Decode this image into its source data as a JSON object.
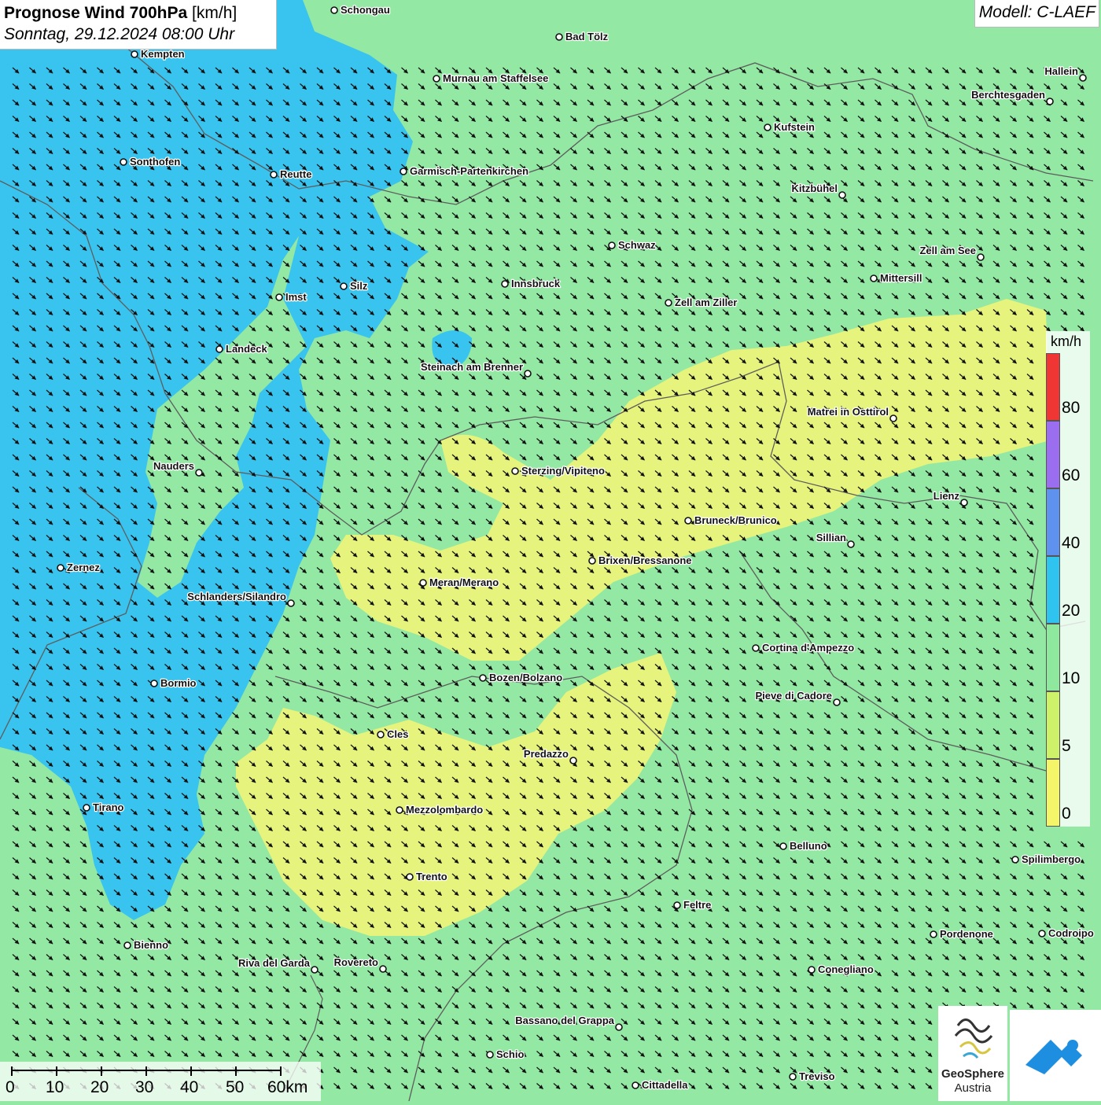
{
  "header": {
    "title_bold": "Prognose Wind 700hPa",
    "title_unit": " [km/h]",
    "subtitle": "Sonntag, 29.12.2024 08:00 Uhr",
    "model": "Modell: C-LAEF"
  },
  "legend": {
    "unit": "km/h",
    "ticks": [
      "80",
      "60",
      "40",
      "20",
      "10",
      "5",
      "0"
    ],
    "colors": [
      "#f03535",
      "#9b6ef0",
      "#5e92ee",
      "#2fc3ef",
      "#8ee89e",
      "#cdf26a",
      "#f5f56a"
    ]
  },
  "scale_bar": {
    "labels": [
      "0",
      "10",
      "20",
      "30",
      "40",
      "50",
      "60km"
    ]
  },
  "logos": {
    "geosphere_line1": "GeoSphere",
    "geosphere_line2": "Austria"
  },
  "colors": {
    "blue_zone": "#39c3ef",
    "green_zone": "#93e8a3",
    "yellow_zone": "#e6f37c",
    "border_line": "#5d5d5d",
    "arrow": "#111111"
  },
  "wind": {
    "direction": "north-west to south-east",
    "level": "700hPa"
  },
  "cities": [
    {
      "name": "Schongau"
    },
    {
      "name": "Bad Tölz"
    },
    {
      "name": "Kempten"
    },
    {
      "name": "Murnau am Staffelsee"
    },
    {
      "name": "Hallein"
    },
    {
      "name": "Berchtesgaden"
    },
    {
      "name": "Kufstein"
    },
    {
      "name": "Sonthofen"
    },
    {
      "name": "Reutte"
    },
    {
      "name": "Garmisch-Partenkirchen"
    },
    {
      "name": "Kitzbühel"
    },
    {
      "name": "Schwaz"
    },
    {
      "name": "Zell am See"
    },
    {
      "name": "Innsbruck"
    },
    {
      "name": "Mittersill"
    },
    {
      "name": "Silz"
    },
    {
      "name": "Imst"
    },
    {
      "name": "Zell am Ziller"
    },
    {
      "name": "Landeck"
    },
    {
      "name": "Steinach am Brenner"
    },
    {
      "name": "Matrei in Osttirol"
    },
    {
      "name": "Nauders"
    },
    {
      "name": "Sterzing/Vipiteno"
    },
    {
      "name": "Lienz"
    },
    {
      "name": "Bruneck/Brunico"
    },
    {
      "name": "Sillian"
    },
    {
      "name": "Brixen/Bressanone"
    },
    {
      "name": "Zernez"
    },
    {
      "name": "Meran/Merano"
    },
    {
      "name": "Schlanders/Silandro"
    },
    {
      "name": "Cortina d'Ampezzo"
    },
    {
      "name": "Bozen/Bolzano"
    },
    {
      "name": "Bormio"
    },
    {
      "name": "Pieve di Cadore"
    },
    {
      "name": "Cles"
    },
    {
      "name": "Predazzo"
    },
    {
      "name": "Tirano"
    },
    {
      "name": "Mezzolombardo"
    },
    {
      "name": "Belluno"
    },
    {
      "name": "Spilimbergo"
    },
    {
      "name": "Trento"
    },
    {
      "name": "Feltre"
    },
    {
      "name": "Pordenone"
    },
    {
      "name": "Codroipo"
    },
    {
      "name": "Bienno"
    },
    {
      "name": "Riva del Garda"
    },
    {
      "name": "Rovereto"
    },
    {
      "name": "Conegliano"
    },
    {
      "name": "Bassano del Grappa"
    },
    {
      "name": "Schio"
    },
    {
      "name": "Treviso"
    },
    {
      "name": "Cittadella"
    }
  ]
}
